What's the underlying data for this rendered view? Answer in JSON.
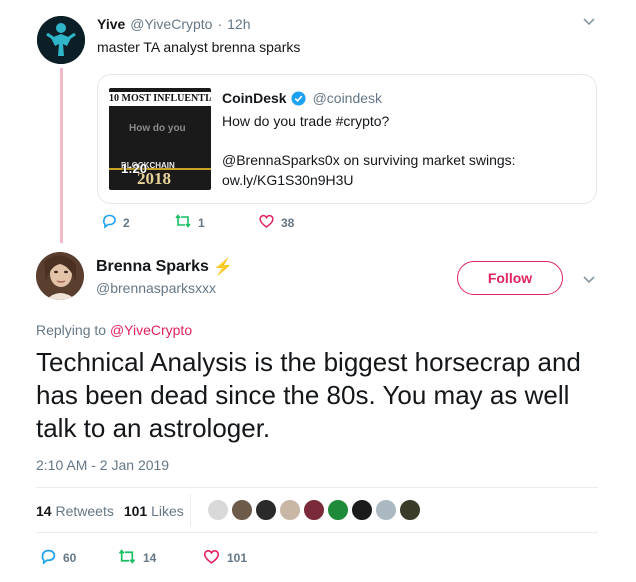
{
  "parent_tweet": {
    "name": "Yive",
    "handle": "@YiveCrypto",
    "separator": "·",
    "time": "12h",
    "text": "master TA analyst brenna sparks",
    "quote": {
      "name": "CoinDesk",
      "handle": "@coindesk",
      "line1": "How do you trade #crypto?",
      "line2": "@BrennaSparks0x on surviving market swings:",
      "link": "ow.ly/KG1S30n9H3U",
      "thumb_top": "10 MOST INFLUENTIA",
      "thumb_mid": "How do you",
      "thumb_bottom": "BLOCKCHAIN",
      "thumb_year": "2018",
      "thumb_duration": "1:20"
    },
    "actions": {
      "replies": "2",
      "retweets": "1",
      "likes": "38"
    }
  },
  "main_tweet": {
    "name": "Brenna Sparks",
    "name_emoji": "⚡",
    "handle": "@brennasparksxxx",
    "follow_label": "Follow",
    "replying_prefix": "Replying to ",
    "replying_handle": "@YiveCrypto",
    "text": "Technical Analysis is the biggest horsecrap and has been dead since the 80s. You may as well talk to an astrologer.",
    "timestamp": "2:10 AM - 2 Jan 2019",
    "retweets_count": "14",
    "retweets_label": "Retweets",
    "likes_count": "101",
    "likes_label": "Likes",
    "actions": {
      "replies": "60",
      "retweets": "14",
      "likes": "101"
    }
  },
  "colors": {
    "accent": "#e0245e",
    "link": "#1da1f2",
    "thread": "#f4b9c6",
    "verified": "#1da1f2"
  }
}
